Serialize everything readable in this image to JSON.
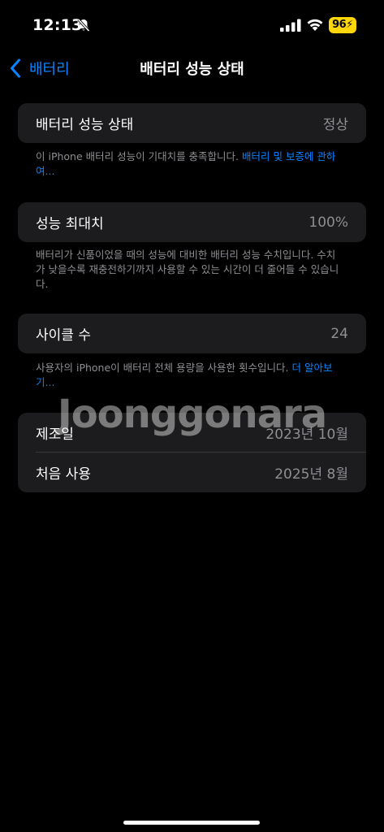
{
  "status_bar": {
    "time": "12:13",
    "battery_level": "96",
    "battery_color": "#ffd60a"
  },
  "nav": {
    "back_label": "배터리",
    "title": "배터리 성능 상태",
    "accent": "#0a84ff"
  },
  "health_section": {
    "label": "배터리 성능 상태",
    "value": "정상",
    "footnote_text": "이 iPhone 배터리 성능이 기대치를 충족합니다. ",
    "footnote_link": "배터리 및 보증에 관하여..."
  },
  "capacity_section": {
    "label": "성능 최대치",
    "value": "100%",
    "footnote_text": "배터리가 신품이었을 때의 성능에 대비한 배터리 성능 수치입니다. 수치가 낮을수록 재충전하기까지 사용할 수 있는 시간이 더 줄어들 수 있습니다."
  },
  "cycle_section": {
    "label": "사이클 수",
    "value": "24",
    "footnote_text": "사용자의 iPhone이 배터리 전체 용량을 사용한 횟수입니다. ",
    "footnote_link": "더 알아보기..."
  },
  "dates_section": {
    "rows": [
      {
        "label": "제조일",
        "value": "2023년 10월"
      },
      {
        "label": "처음 사용",
        "value": "2025년 8월"
      }
    ]
  },
  "watermark": "Joonggonara"
}
